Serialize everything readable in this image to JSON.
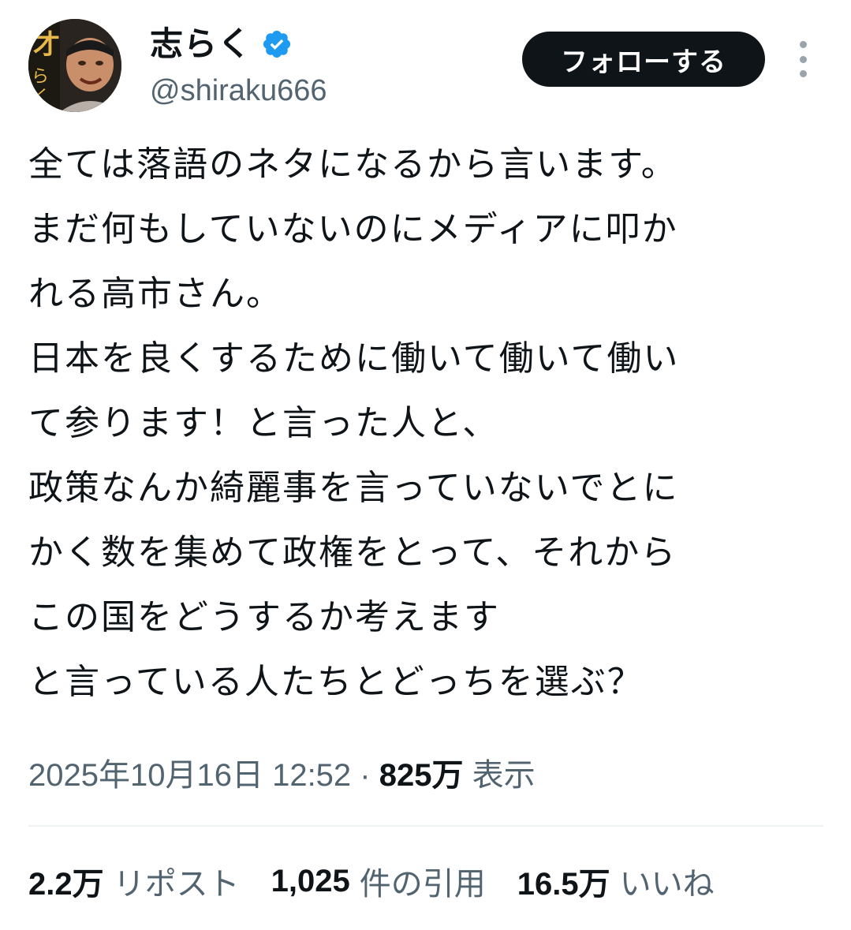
{
  "author": {
    "display_name": "志らく",
    "handle": "@shiraku666",
    "verified": true,
    "avatar_text": "才"
  },
  "actions": {
    "follow_label": "フォローする",
    "more_icon": "more-vertical-icon"
  },
  "tweet": {
    "lines": [
      "全ては落語のネタになるから言います。",
      "まだ何もしていないのにメディアに叩か",
      "れる高市さん。",
      "日本を良くするために働いて働いて働い",
      "て参ります！と言った人と、",
      "政策なんか綺麗事を言っていないでとに",
      "かく数を集めて政権をとって、それから",
      "この国をどうするか考えます",
      "と言っている人たちとどっちを選ぶ？"
    ]
  },
  "meta": {
    "timestamp": "2025年10月16日 12:52",
    "separator": " · ",
    "views_count": "825万",
    "views_label": " 表示"
  },
  "stats": {
    "reposts": {
      "count": "2.2万",
      "label": "リポスト"
    },
    "quotes": {
      "count": "1,025",
      "label": "件の引用"
    },
    "likes": {
      "count": "16.5万",
      "label": "いいね"
    }
  },
  "colors": {
    "text_primary": "#0f1419",
    "text_secondary": "#536471",
    "verified_blue": "#1d9bf0",
    "follow_bg": "#0f1419",
    "divider": "#eff3f4"
  }
}
